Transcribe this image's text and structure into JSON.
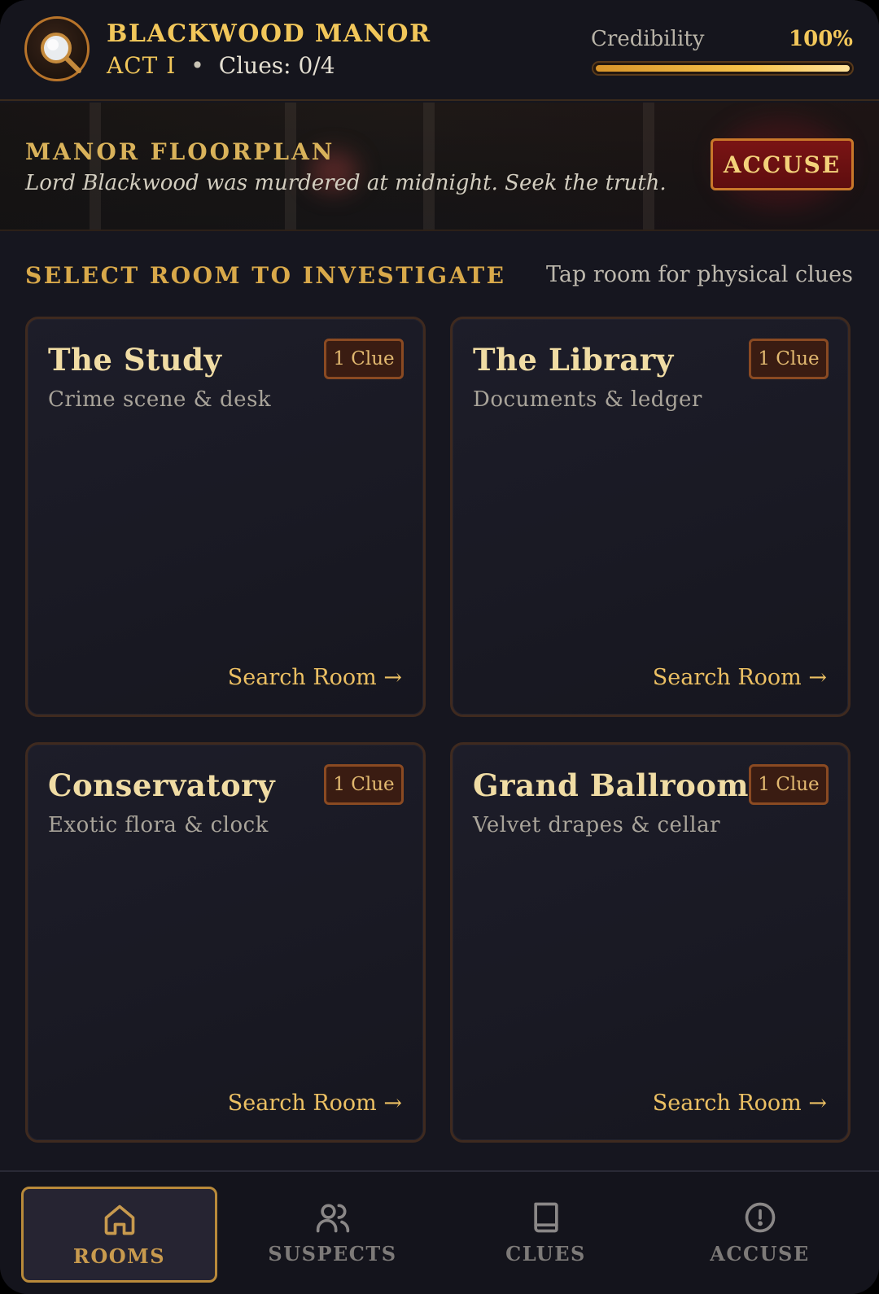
{
  "header": {
    "title": "BLACKWOOD MANOR",
    "act": "ACT I",
    "separator": "•",
    "clues": "Clues: 0/4",
    "credibility_label": "Credibility",
    "credibility_value": "100%",
    "credibility_level": 1.0,
    "logo_icon": "magnifying-glass-icon"
  },
  "banner": {
    "title": "MANOR FLOORPLAN",
    "subtitle": "Lord Blackwood was murdered at midnight. Seek the truth.",
    "accuse_label": "ACCUSE"
  },
  "section": {
    "title": "SELECT ROOM TO INVESTIGATE",
    "hint": "Tap room for physical clues"
  },
  "rooms": [
    {
      "name": "The Study",
      "desc": "Crime scene & desk",
      "badge": "1 Clue",
      "action": "Search Room →"
    },
    {
      "name": "The Library",
      "desc": "Documents & ledger",
      "badge": "1 Clue",
      "action": "Search Room →"
    },
    {
      "name": "Conservatory",
      "desc": "Exotic flora & clock",
      "badge": "1 Clue",
      "action": "Search Room →"
    },
    {
      "name": "Grand Ballroom",
      "desc": "Velvet drapes & cellar",
      "badge": "1 Clue",
      "action": "Search Room →"
    }
  ],
  "nav": {
    "items": [
      {
        "label": "ROOMS",
        "icon": "home-icon",
        "active": true
      },
      {
        "label": "SUSPECTS",
        "icon": "users-icon",
        "active": false
      },
      {
        "label": "CLUES",
        "icon": "book-icon",
        "active": false
      },
      {
        "label": "ACCUSE",
        "icon": "alert-circle-icon",
        "active": false
      }
    ]
  },
  "colors": {
    "gold": "#f2c75a",
    "accent_red": "#7a1414",
    "background": "#16161f",
    "card_border": "#3f2a1f"
  }
}
